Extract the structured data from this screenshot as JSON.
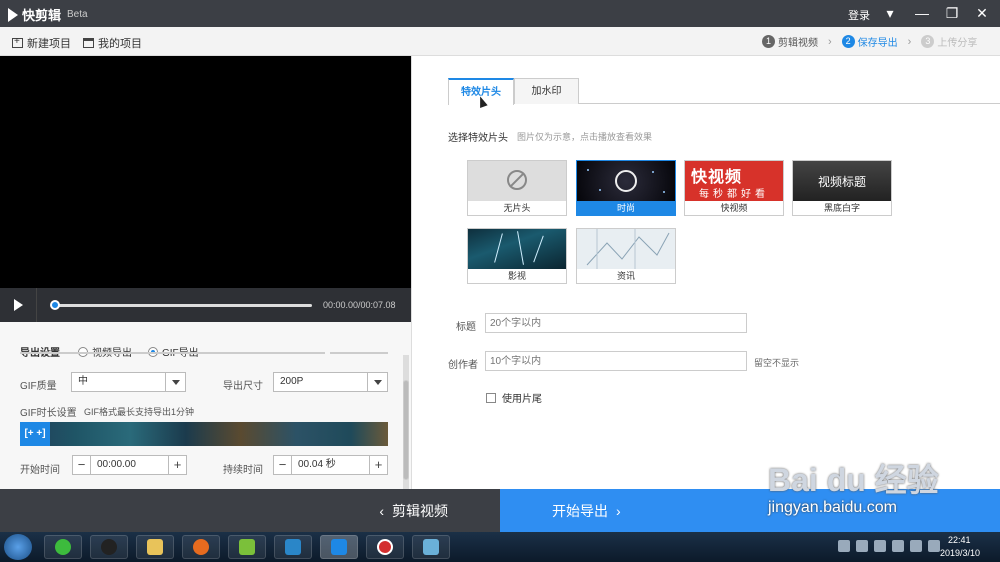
{
  "app": {
    "name": "快剪辑",
    "edition": "Beta",
    "login": "登录"
  },
  "toolbar": {
    "new_project": "新建项目",
    "my_projects": "我的项目"
  },
  "steps": [
    {
      "num": "1",
      "label": "剪辑视频"
    },
    {
      "num": "2",
      "label": "保存导出"
    },
    {
      "num": "3",
      "label": "上传分享"
    }
  ],
  "player": {
    "timecode": "00:00.00/00:07.08",
    "progress": 0
  },
  "export": {
    "settings_label": "导出设置",
    "mode_video": "视频导出",
    "mode_gif": "GIF导出",
    "gif_quality_label": "GIF质量",
    "gif_quality_value": "中",
    "size_label": "导出尺寸",
    "size_value": "200P",
    "duration_label": "GIF时长设置",
    "duration_hint": "GIF格式最长支持导出1分钟",
    "start_label": "开始时间",
    "start_value": "00:00.00",
    "length_label": "持续时间",
    "length_value": "00.04 秒",
    "handle_text": "[+ +]"
  },
  "tabs": [
    {
      "label": "特效片头"
    },
    {
      "label": "加水印"
    }
  ],
  "intro": {
    "title": "选择特效片头",
    "hint": "图片仅为示意，点击播放查看效果",
    "items": [
      {
        "label": "无片头"
      },
      {
        "label": "时尚"
      },
      {
        "label": "快视频",
        "art_big": "快视频",
        "art_small": "每秒都好看"
      },
      {
        "label": "黑底白字",
        "art_text": "视频标题"
      },
      {
        "label": "影视"
      },
      {
        "label": "资讯"
      }
    ],
    "selected": "时尚"
  },
  "fields": {
    "title_label": "标题",
    "title_placeholder": "20个字以内",
    "author_label": "创作者",
    "author_placeholder": "10个字以内",
    "author_hint": "留空不显示",
    "use_ending": "使用片尾"
  },
  "actions": {
    "back": "剪辑视频",
    "export": "开始导出"
  },
  "watermark": {
    "line1": "Bai du 经验",
    "line2": "jingyan.baidu.com"
  },
  "taskbar": {
    "time": "22:41",
    "date": "2019/3/10"
  },
  "colors": {
    "accent": "#1e88e5",
    "dark": "#3c3f45",
    "export_btn": "#2f8ef2"
  }
}
